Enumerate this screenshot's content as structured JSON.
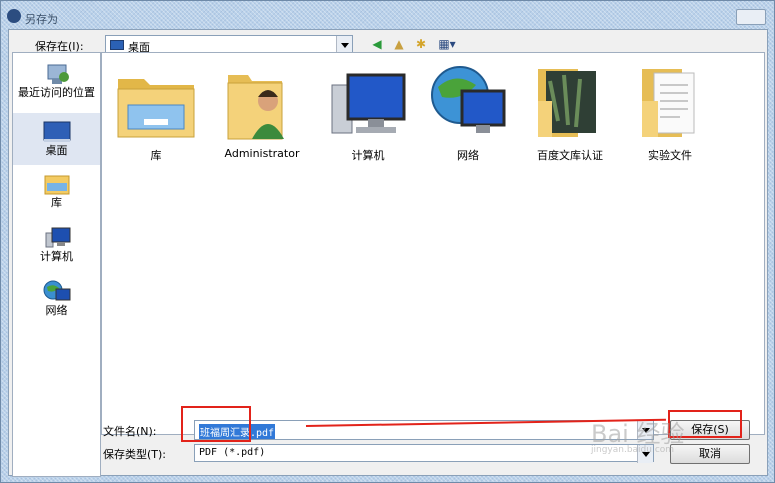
{
  "window": {
    "title": "另存为"
  },
  "toolbar": {
    "save_in_label": "保存在(I):",
    "location": "桌面"
  },
  "places": [
    {
      "label": "最近访问的位置"
    },
    {
      "label": "桌面"
    },
    {
      "label": "库"
    },
    {
      "label": "计算机"
    },
    {
      "label": "网络"
    }
  ],
  "files": [
    {
      "label": "库"
    },
    {
      "label": "Administrator"
    },
    {
      "label": "计算机"
    },
    {
      "label": "网络"
    },
    {
      "label": "百度文库认证"
    },
    {
      "label": "实验文件"
    }
  ],
  "form": {
    "filename_label": "文件名(N):",
    "filename_value": "班福周汇录.pdf",
    "filetype_label": "保存类型(T):",
    "filetype_value": "PDF (*.pdf)"
  },
  "buttons": {
    "save": "保存(S)",
    "cancel": "取消"
  },
  "watermark": {
    "main": "Bai 经验",
    "sub": "jingyan.baidu.com"
  },
  "colors": {
    "annotation": "#e2231a",
    "selection": "#3179d8"
  }
}
